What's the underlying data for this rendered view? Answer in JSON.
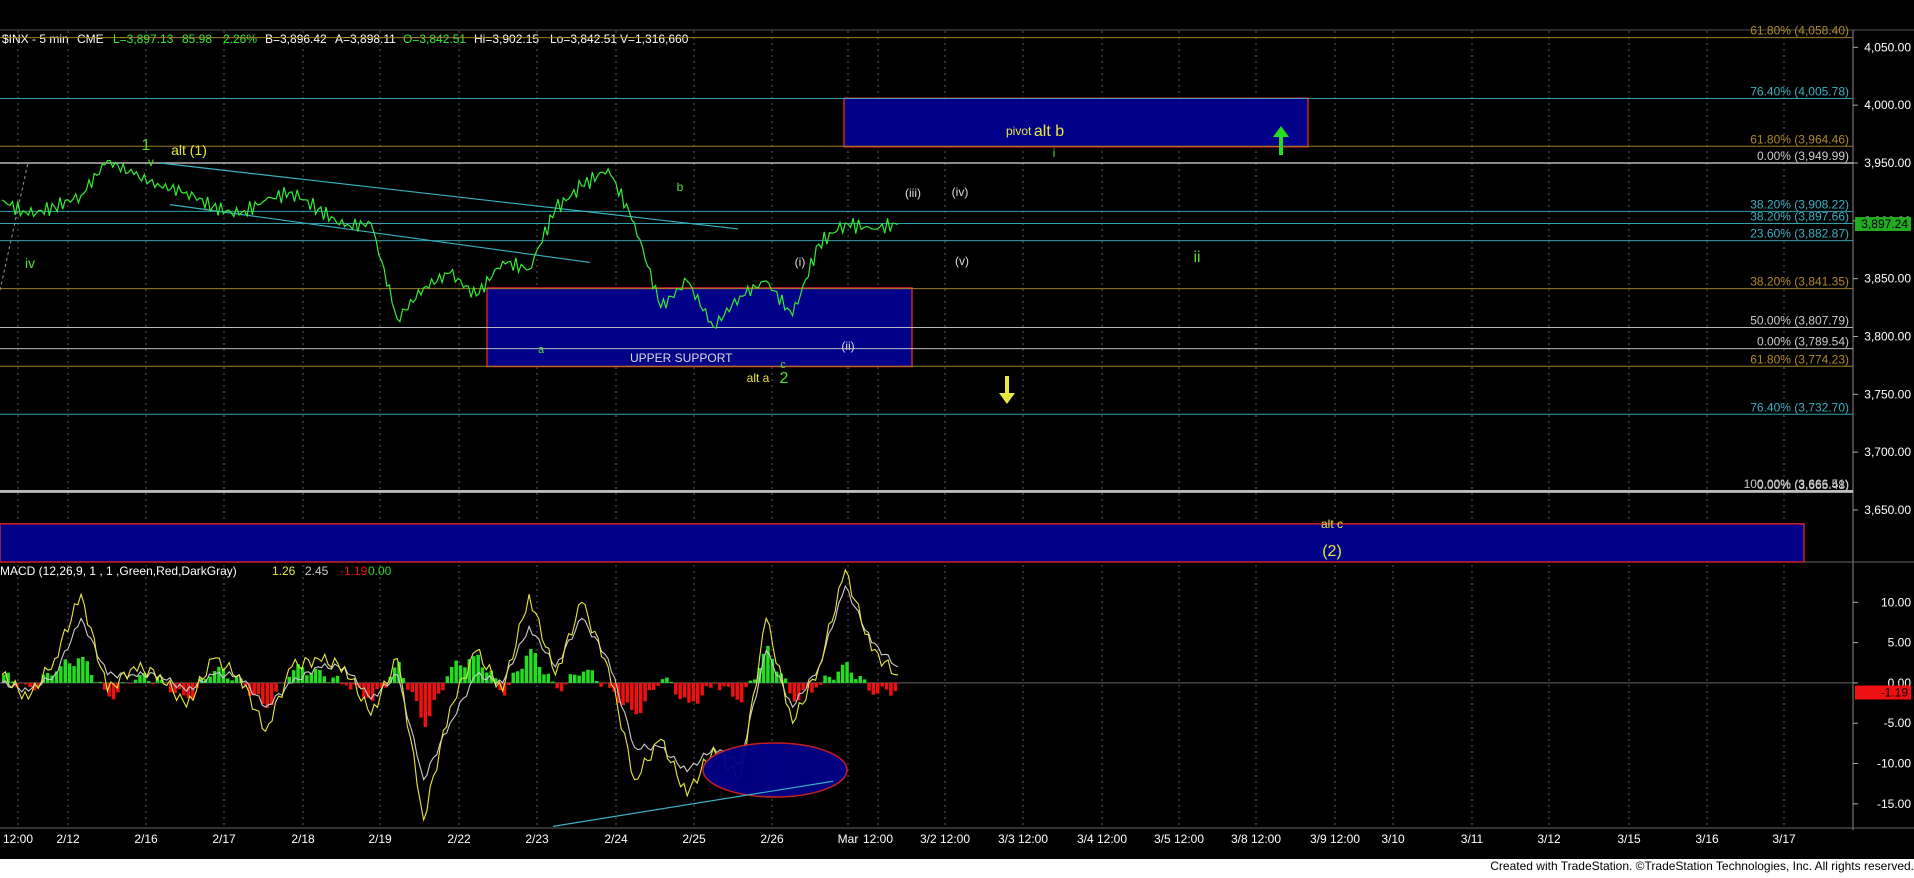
{
  "header": {
    "symbol": "$INX - 5 min",
    "exchange": "CME",
    "last": "L=3,897.13",
    "change": "85.98",
    "pct": "2.26%",
    "bid": "B=3,896.42",
    "ask": "A=3,898.11",
    "open": "O=3,842.51",
    "high": "Hi=3,902.15",
    "low": "Lo=3,842.51",
    "volume": "V=1,316,660"
  },
  "footer": "Created with TradeStation. ©TradeStation Technologies, Inc. All rights reserved.",
  "colors": {
    "price": "#33ee33",
    "box_fill": "#000088",
    "box_border": "#cc2222",
    "fib_cyan": "#3ab0c0",
    "fib_gold": "#b08a2a",
    "label_green": "#55dd33",
    "label_yellow": "#e8e840",
    "label_white": "#dddddd",
    "macd_fast": "#e8e840",
    "macd_slow": "#cccccc",
    "hist_pos": "#22dd22",
    "hist_neg": "#ee1111"
  },
  "chart_data": [
    {
      "type": "line",
      "panel": "price",
      "ylim": [
        3605,
        4065
      ],
      "y_ticks": [
        "4,050.00",
        "4,000.00",
        "3,950.00",
        "3,900.00",
        "3,850.00",
        "3,800.00",
        "3,750.00",
        "3,700.00",
        "3,650.00"
      ],
      "last_price_label": "3,897.24",
      "x_tick_labels": [
        "12:00",
        "2/12",
        "2/16",
        "2/17",
        "2/18",
        "2/19",
        "2/22",
        "2/23",
        "2/24",
        "2/25",
        "2/26",
        "Mar",
        "12:00",
        "3/2 12:00",
        "3/3 12:00",
        "3/4 12:00",
        "3/5 12:00",
        "3/8 12:00",
        "3/9 12:00",
        "3/10",
        "3/11",
        "3/12",
        "3/15",
        "3/16",
        "3/17"
      ],
      "series": [
        {
          "x": [
            "2/11",
            "2/12",
            "2/12",
            "2/16",
            "2/16",
            "2/16",
            "2/17",
            "2/17",
            "2/18",
            "2/18",
            "2/19",
            "2/19",
            "2/22",
            "2/22",
            "2/22",
            "2/23",
            "2/23",
            "2/23",
            "2/23",
            "2/24",
            "2/24",
            "2/24",
            "2/25",
            "2/25",
            "2/25",
            "2/25",
            "2/26",
            "2/26",
            "2/26",
            "2/26",
            "2/26",
            "3/1",
            "3/1",
            "3/1",
            "3/1"
          ],
          "values": [
            3918,
            3905,
            3912,
            3922,
            3952,
            3940,
            3930,
            3925,
            3912,
            3905,
            3918,
            3925,
            3910,
            3895,
            3898,
            3815,
            3842,
            3855,
            3835,
            3865,
            3858,
            3910,
            3930,
            3945,
            3898,
            3825,
            3848,
            3808,
            3835,
            3848,
            3818,
            3880,
            3898,
            3893,
            3897
          ]
        }
      ],
      "horizontal_levels": [
        {
          "label": "61.80% (4,058.40)",
          "price": 4058.4,
          "color": "fib_gold"
        },
        {
          "label": "76.40% (4,005.78)",
          "price": 4005.78,
          "color": "fib_cyan"
        },
        {
          "label": "61.80% (3,964.46)",
          "price": 3964.46,
          "color": "fib_gold"
        },
        {
          "label": "0.00% (3,949.99)",
          "price": 3949.99,
          "color": "white"
        },
        {
          "label": "38.20% (3,908.22)",
          "price": 3908.22,
          "color": "fib_cyan"
        },
        {
          "label": "38.20% (3,897.66)",
          "price": 3897.66,
          "color": "fib_cyan"
        },
        {
          "label": "23.60% (3,882.87)",
          "price": 3882.87,
          "color": "fib_cyan"
        },
        {
          "label": "38.20% (3,841.35)",
          "price": 3841.35,
          "color": "fib_gold"
        },
        {
          "label": "50.00% (3,807.79)",
          "price": 3807.79,
          "color": "white"
        },
        {
          "label": "0.00% (3,789.54)",
          "price": 3789.54,
          "color": "white"
        },
        {
          "label": "61.80% (3,774.23)",
          "price": 3774.23,
          "color": "fib_gold"
        },
        {
          "label": "76.40% (3,732.70)",
          "price": 3732.7,
          "color": "fib_cyan"
        },
        {
          "label": "100.00% (3,666.51)",
          "price": 3666.51,
          "color": "white"
        },
        {
          "label": "0.00% (3,665.48)",
          "price": 3665.48,
          "color": "white"
        }
      ],
      "zones": [
        {
          "label": "UPPER SUPPORT",
          "x": [
            "2/22",
            "3/1"
          ],
          "price": [
            3774,
            3842
          ]
        },
        {
          "label": "pivot",
          "x": [
            "3/1",
            "3/9"
          ],
          "price": [
            3964,
            4006
          ]
        },
        {
          "label": "",
          "x": [
            "2/11",
            "3/17"
          ],
          "price": [
            3605,
            3638
          ]
        }
      ],
      "wave_labels": [
        {
          "text": "1",
          "color": "label_green"
        },
        {
          "text": "v",
          "color": "label_green"
        },
        {
          "text": "alt (1)",
          "color": "label_yellow"
        },
        {
          "text": "iv",
          "color": "label_green"
        },
        {
          "text": "b",
          "color": "label_green"
        },
        {
          "text": "a",
          "color": "label_green"
        },
        {
          "text": "c",
          "color": "label_green"
        },
        {
          "text": "2",
          "color": "label_green"
        },
        {
          "text": "alt a",
          "color": "label_yellow"
        },
        {
          "text": "(i)",
          "color": "label_white"
        },
        {
          "text": "(ii)",
          "color": "label_white"
        },
        {
          "text": "(iii)",
          "color": "label_white"
        },
        {
          "text": "(iv)",
          "color": "label_white"
        },
        {
          "text": "alt b",
          "color": "label_yellow"
        },
        {
          "text": "i",
          "color": "label_green"
        },
        {
          "text": "(v)",
          "color": "label_white"
        },
        {
          "text": "ii",
          "color": "label_green"
        },
        {
          "text": "alt c",
          "color": "label_yellow"
        },
        {
          "text": "(2)",
          "color": "label_yellow"
        }
      ]
    },
    {
      "type": "line",
      "panel": "macd",
      "title": "MACD (12,26,9, 1 , 1 ,Green,Red,DarkGray)",
      "readouts": [
        "1.26",
        "2.45",
        "-1.19",
        "0.00"
      ],
      "ylim": [
        -18,
        15
      ],
      "y_ticks": [
        "10.00",
        "5.00",
        "0.00",
        "-5.00",
        "-10.00",
        "-15.00"
      ],
      "last_value_label": "-1.19",
      "macd": [
        1,
        -2,
        3,
        11,
        -1,
        2,
        1,
        -3,
        3,
        1,
        -6,
        2,
        3,
        2,
        -4,
        3,
        -17,
        -3,
        4,
        -1,
        11,
        1,
        10,
        2,
        -12,
        -7,
        -14,
        -8,
        -12,
        8,
        -5,
        2,
        14,
        4,
        1
      ],
      "signal": [
        0,
        -1,
        1,
        8,
        1,
        1,
        1,
        -1,
        1,
        1,
        -3,
        0,
        2,
        2,
        -2,
        1,
        -12,
        -5,
        1,
        0,
        7,
        2,
        8,
        3,
        -8,
        -8,
        -11,
        -8,
        -10,
        4,
        -3,
        2,
        12,
        5,
        2
      ],
      "histogram": [
        1,
        -1,
        2,
        3,
        -2,
        1,
        0,
        -2,
        2,
        0,
        -3,
        2,
        1,
        0,
        -2,
        2,
        -5,
        2,
        3,
        -1,
        4,
        -1,
        2,
        -1,
        -4,
        1,
        -3,
        0,
        -2,
        4,
        -2,
        0,
        2,
        -1,
        -1
      ]
    }
  ]
}
